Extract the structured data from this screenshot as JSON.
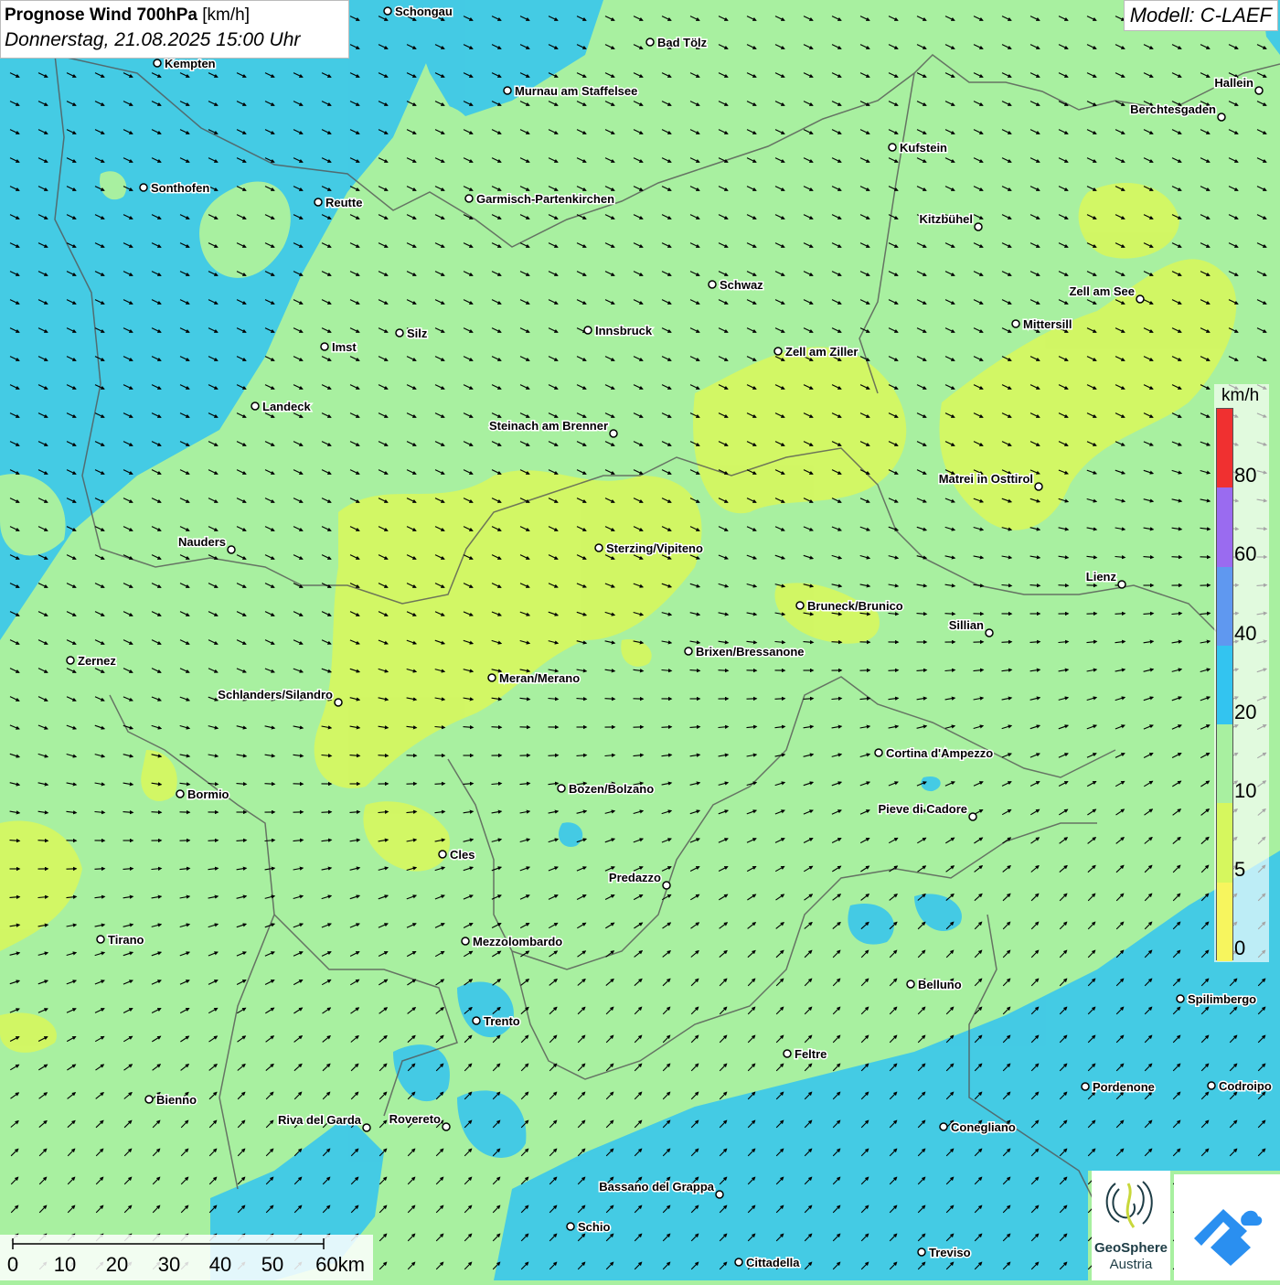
{
  "title": {
    "main": "Prognose Wind 700hPa",
    "unit": "[km/h]",
    "datetime": "Donnerstag, 21.08.2025 15:00 Uhr"
  },
  "model": "Modell: C-LAEF",
  "legend": {
    "unit": "km/h",
    "ticks": [
      "80",
      "60",
      "40",
      "20",
      "10",
      "5",
      "0"
    ],
    "colors": [
      "#f03030",
      "#9a6bf0",
      "#5f98f0",
      "#33c4f0",
      "#a8f0a0",
      "#d6f75e",
      "#f7f55e"
    ]
  },
  "scalebar": {
    "labels": [
      "0",
      "10",
      "20",
      "30",
      "40",
      "50",
      "60km"
    ]
  },
  "logos": {
    "geosphere_line1": "GeoSphere",
    "geosphere_line2": "Austria"
  },
  "colors": {
    "wind_low": "#d6f75e",
    "wind_mid": "#a8f0a0",
    "wind_high": "#33c4f0",
    "border": "#555555",
    "brand": "#2a8ff0"
  },
  "cities": [
    "Schongau",
    "Bad Tölz",
    "Kempten",
    "Murnau am Staffelsee",
    "Hallein",
    "Berchtesgaden",
    "Kufstein",
    "Sonthofen",
    "Reutte",
    "Garmisch-Partenkirchen",
    "Kitzbühel",
    "Schwaz",
    "Zell am See",
    "Mittersill",
    "Innsbruck",
    "Silz",
    "Imst",
    "Zell am Ziller",
    "Landeck",
    "Steinach am Brenner",
    "Matrei in Osttirol",
    "Nauders",
    "Sterzing/Vipiteno",
    "Lienz",
    "Bruneck/Brunico",
    "Sillian",
    "Brixen/Bressanone",
    "Zernez",
    "Meran/Merano",
    "Schlanders/Silandro",
    "Cortina d'Ampezzo",
    "Bozen/Bolzano",
    "Bormio",
    "Pieve di Cadore",
    "Cles",
    "Predazzo",
    "Tirano",
    "Mezzolombardo",
    "Belluno",
    "Spilimbergo",
    "Trento",
    "Feltre",
    "Bienno",
    "Pordenone",
    "Codroipo",
    "Riva del Garda",
    "Rovereto",
    "Conegliano",
    "Bassano del Grappa",
    "Schio",
    "Treviso",
    "Cittadella"
  ]
}
